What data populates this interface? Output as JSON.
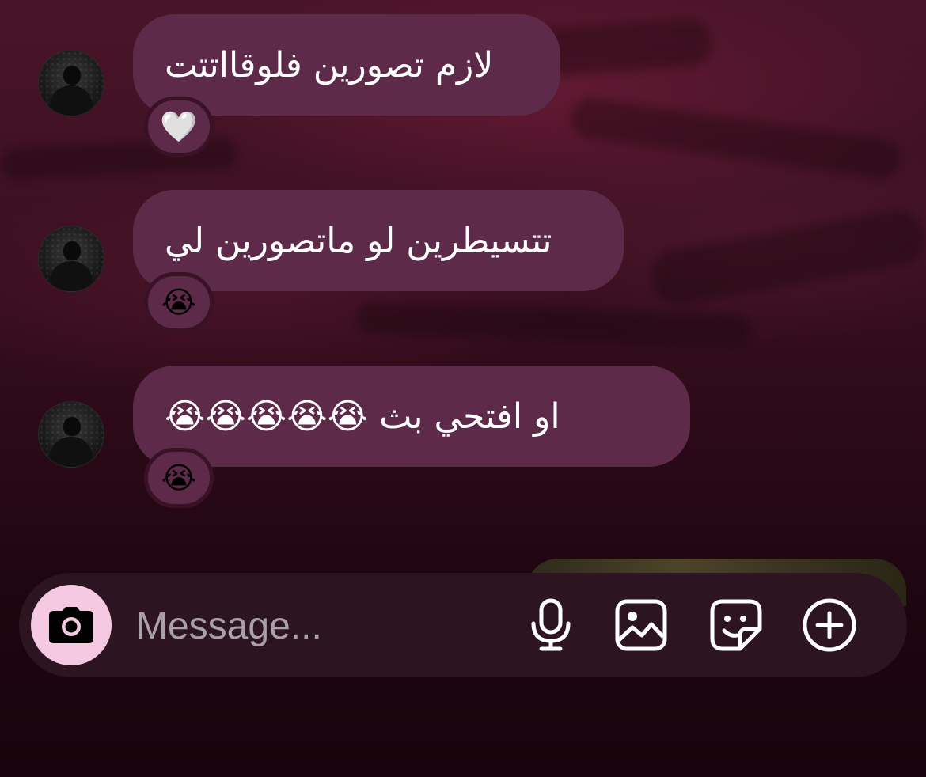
{
  "messages": [
    {
      "text": "لازم تصورين فلوقااتتت",
      "reaction": "🤍"
    },
    {
      "text": "تتسيطرين لو ماتصورين لي",
      "reaction": "😭"
    },
    {
      "text": "او افتحي بث 😭😭😭😭😭",
      "reaction": "😭"
    }
  ],
  "composer": {
    "placeholder": "Message...",
    "icons": [
      "camera-icon",
      "microphone-icon",
      "gallery-icon",
      "sticker-icon",
      "add-icon"
    ]
  },
  "colors": {
    "bubble": "#5e2a4a",
    "camera_button": "#f4c9e1",
    "composer_bg": "#2c1420"
  }
}
